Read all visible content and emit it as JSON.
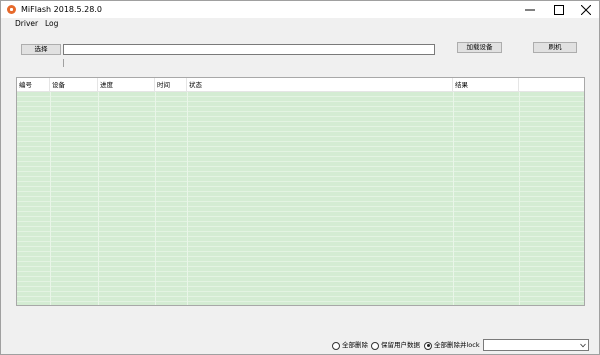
{
  "window": {
    "title": "MiFlash 2018.5.28.0",
    "accent_color": "#e66a2c"
  },
  "menu": {
    "items": [
      "Driver",
      "Log"
    ]
  },
  "toolbar": {
    "select_label": "选择",
    "path_value": "",
    "load_devices_label": "加载设备",
    "flash_label": "刷机"
  },
  "table": {
    "columns": [
      "编号",
      "设备",
      "进度",
      "时间",
      "状态",
      "结果",
      ""
    ],
    "rows": [],
    "row_color": "#d4ecd3"
  },
  "options": {
    "modes": [
      {
        "label": "全部删除",
        "checked": false
      },
      {
        "label": "保留用户数据",
        "checked": false
      },
      {
        "label": "全部删除并lock",
        "checked": true
      }
    ],
    "combo_value": ""
  }
}
